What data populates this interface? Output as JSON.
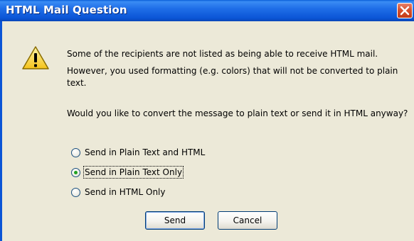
{
  "window": {
    "title": "HTML Mail Question"
  },
  "icons": {
    "warning": "warning-icon",
    "close": "close-icon"
  },
  "message": {
    "line1": "Some of the recipients are not listed as being able to receive HTML mail.",
    "line2": "However, you used formatting (e.g. colors) that will not be converted to plain text.",
    "question": "Would you like to convert the message to plain text or send it in HTML anyway?"
  },
  "options": [
    {
      "label": "Send in Plain Text and HTML",
      "checked": false
    },
    {
      "label": "Send in Plain Text Only",
      "checked": true
    },
    {
      "label": "Send in HTML Only",
      "checked": false
    }
  ],
  "buttons": {
    "send": "Send",
    "cancel": "Cancel"
  },
  "colors": {
    "titlebar": "#0b55d6",
    "dialog_bg": "#ece9d8",
    "close_button": "#d6502e",
    "radio_dot": "#21a121"
  }
}
